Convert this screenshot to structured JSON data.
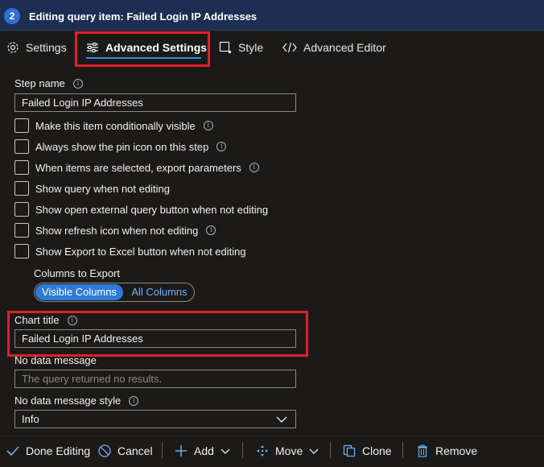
{
  "header": {
    "step_number": "2",
    "title": "Editing query item: Failed Login IP Addresses"
  },
  "tabs": [
    {
      "label": "Settings",
      "icon": "gear-icon",
      "active": false
    },
    {
      "label": "Advanced Settings",
      "icon": "sliders-icon",
      "active": true
    },
    {
      "label": "Style",
      "icon": "square-icon",
      "active": false
    },
    {
      "label": "Advanced Editor",
      "icon": "code-icon",
      "active": false
    }
  ],
  "step_name": {
    "label": "Step name",
    "value": "Failed Login IP Addresses"
  },
  "checkboxes": [
    {
      "label": "Make this item conditionally visible",
      "info": true,
      "checked": false
    },
    {
      "label": "Always show the pin icon on this step",
      "info": true,
      "checked": false
    },
    {
      "label": "When items are selected, export parameters",
      "info": true,
      "checked": false
    },
    {
      "label": "Show query when not editing",
      "info": false,
      "checked": false
    },
    {
      "label": "Show open external query button when not editing",
      "info": false,
      "checked": false
    },
    {
      "label": "Show refresh icon when not editing",
      "info": true,
      "checked": false
    },
    {
      "label": "Show Export to Excel button when not editing",
      "info": false,
      "checked": false
    }
  ],
  "columns_to_export": {
    "label": "Columns to Export",
    "options": [
      "Visible Columns",
      "All Columns"
    ],
    "selected": "Visible Columns"
  },
  "chart_title": {
    "label": "Chart title",
    "value": "Failed Login IP Addresses"
  },
  "no_data_message": {
    "label": "No data message",
    "placeholder": "The query returned no results."
  },
  "no_data_message_style": {
    "label": "No data message style",
    "value": "Info"
  },
  "footer": {
    "done": "Done Editing",
    "cancel": "Cancel",
    "add": "Add",
    "move": "Move",
    "clone": "Clone",
    "remove": "Remove"
  },
  "colors": {
    "accent": "#3a8ee6",
    "highlight_box": "#e21f2a",
    "header_bg": "#1d2e52"
  }
}
